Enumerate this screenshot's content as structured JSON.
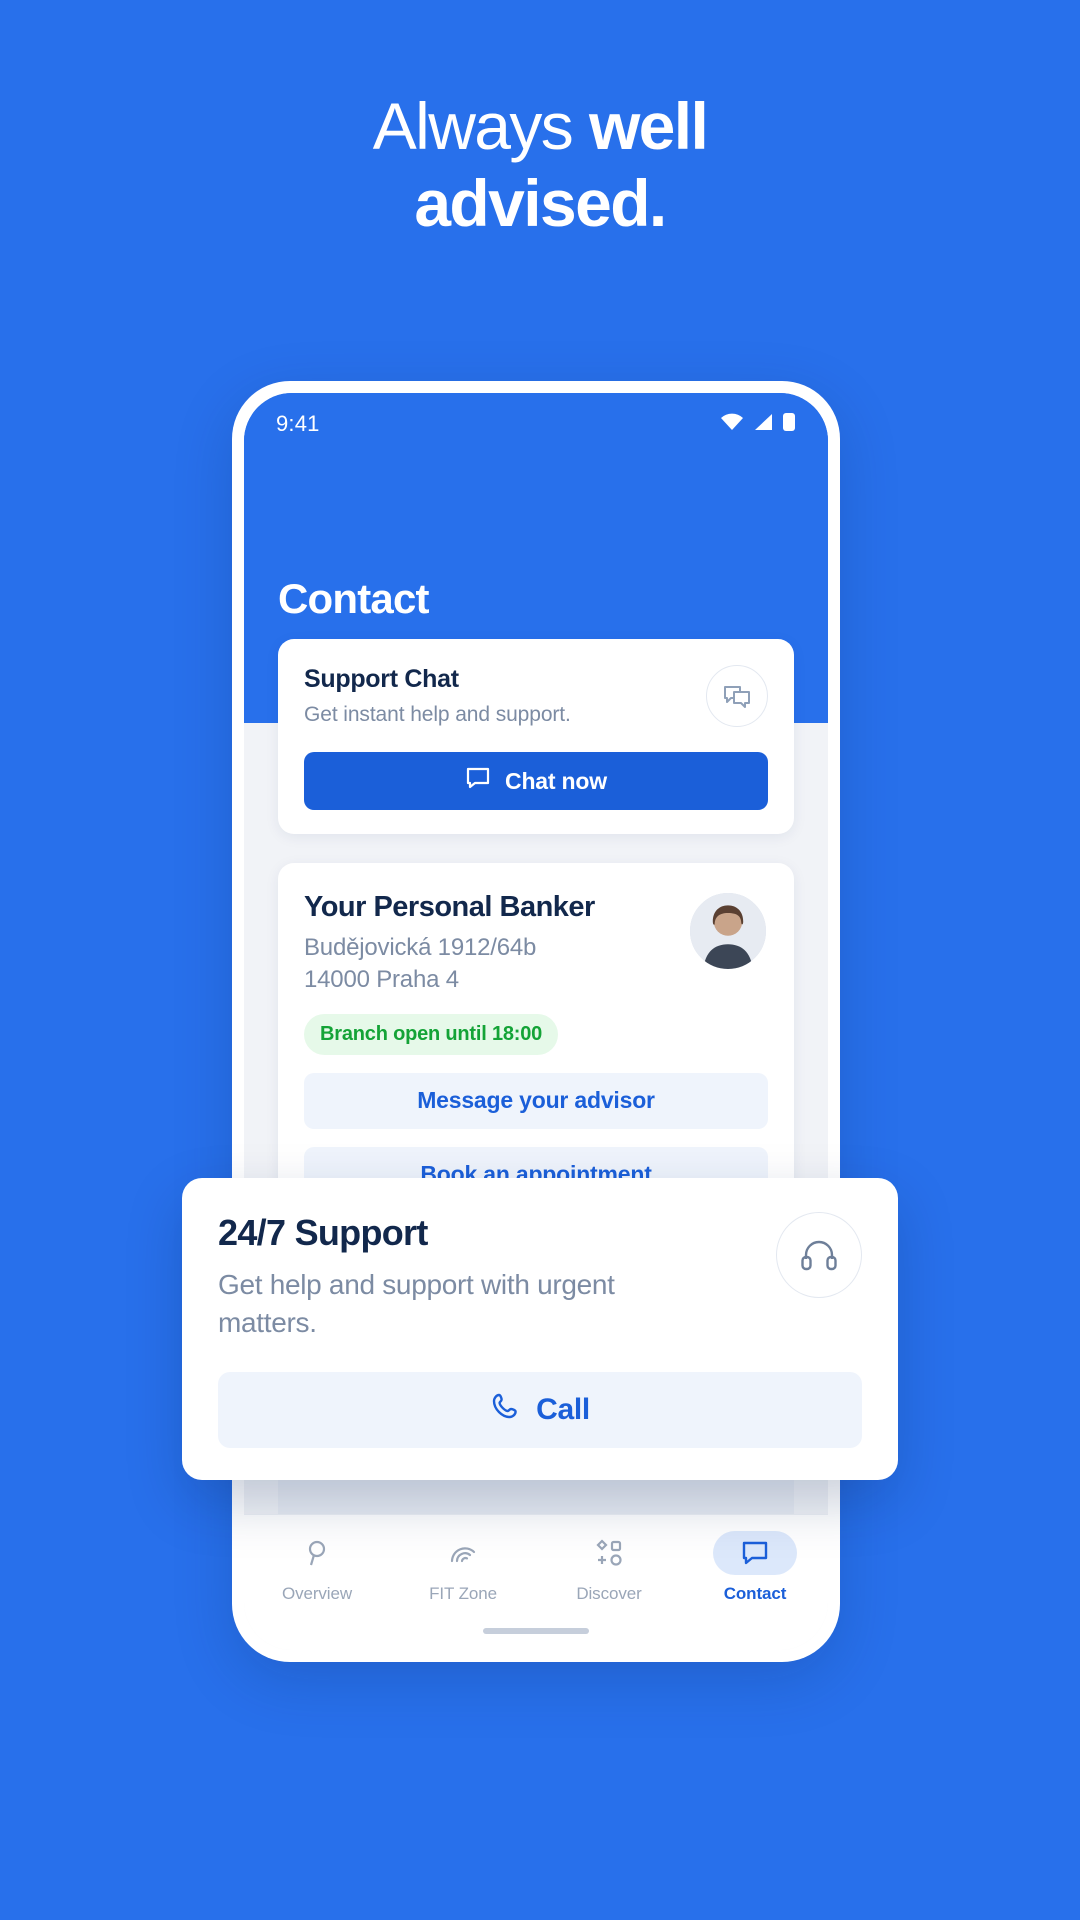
{
  "hero": {
    "line1_regular": "Always ",
    "line1_bold": "well",
    "line2_bold": "advised."
  },
  "colors": {
    "brand_blue": "#2870EB",
    "button_blue": "#1B5FD9",
    "soft_blue": "#EFF4FC",
    "navy_text": "#12284C",
    "gray_text": "#7C8BA3",
    "badge_green_text": "#14A337",
    "badge_green_bg": "#E6F9E9"
  },
  "phone": {
    "statusbar": {
      "time": "9:41",
      "icons": [
        "wifi-icon",
        "cellular-signal-icon",
        "battery-icon"
      ]
    },
    "page_title": "Contact",
    "support_chat_card": {
      "title": "Support Chat",
      "subtitle": "Get instant help and support.",
      "icon": "chat-bubbles-icon",
      "button_label": "Chat now",
      "button_icon": "chat-bubble-icon"
    },
    "banker_card": {
      "title": "Your Personal Banker",
      "address_line1": "Budějovická 1912/64b",
      "address_line2": "14000 Praha 4",
      "badge": "Branch open until 18:00",
      "avatar": "advisor-photo",
      "actions": [
        {
          "label": "Message your advisor"
        },
        {
          "label": "Book an appointment"
        }
      ]
    },
    "bottom_nav": [
      {
        "label": "Overview",
        "icon": "overview-icon",
        "active": false
      },
      {
        "label": "FIT Zone",
        "icon": "fit-zone-icon",
        "active": false
      },
      {
        "label": "Discover",
        "icon": "discover-icon",
        "active": false
      },
      {
        "label": "Contact",
        "icon": "chat-bubble-icon",
        "active": true
      }
    ]
  },
  "float_card": {
    "title": "24/7 Support",
    "subtitle": "Get help and support with urgent matters.",
    "icon": "headset-icon",
    "button_label": "Call",
    "button_icon": "phone-icon"
  }
}
